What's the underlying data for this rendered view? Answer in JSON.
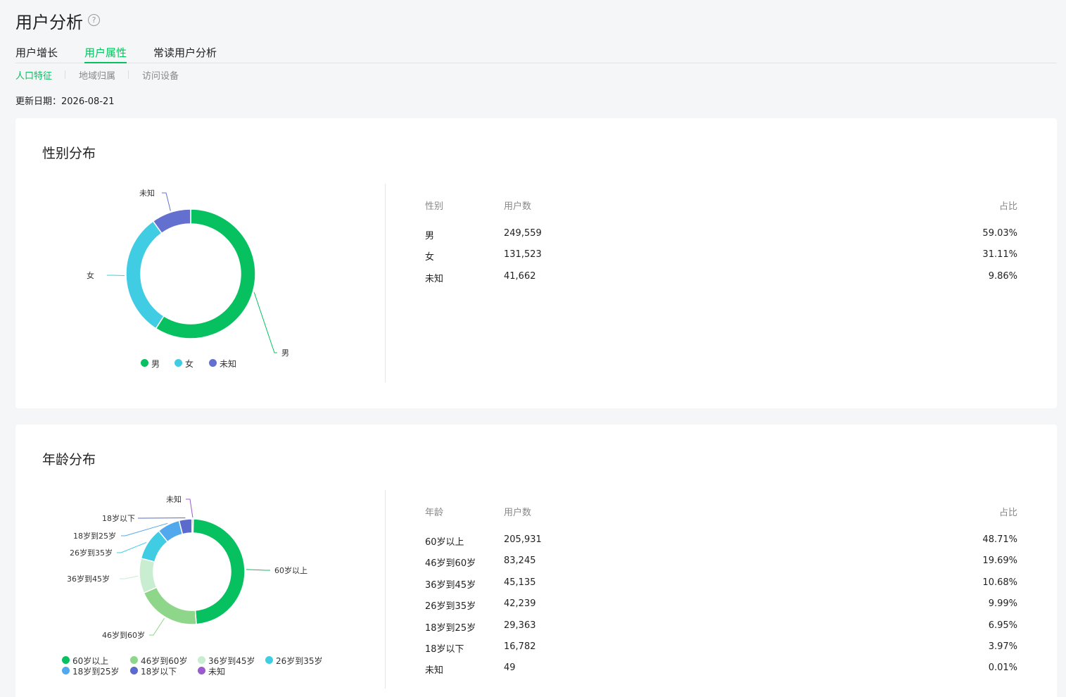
{
  "header": {
    "title": "用户分析",
    "help_icon": "?"
  },
  "tabs": [
    {
      "label": "用户增长"
    },
    {
      "label": "用户属性",
      "active": true
    },
    {
      "label": "常读用户分析"
    }
  ],
  "subtabs": [
    {
      "label": "人口特征",
      "active": true
    },
    {
      "label": "地域归属"
    },
    {
      "label": "访问设备"
    }
  ],
  "update": {
    "label": "更新日期：",
    "date": "2026-08-21"
  },
  "gender": {
    "title": "性别分布",
    "table": {
      "headers": [
        "性别",
        "用户数",
        "占比"
      ],
      "rows": [
        [
          "男",
          "249,559",
          "59.03%"
        ],
        [
          "女",
          "131,523",
          "31.11%"
        ],
        [
          "未知",
          "41,662",
          "9.86%"
        ]
      ]
    }
  },
  "age": {
    "title": "年龄分布",
    "table": {
      "headers": [
        "年龄",
        "用户数",
        "占比"
      ],
      "rows": [
        [
          "60岁以上",
          "205,931",
          "48.71%"
        ],
        [
          "46岁到60岁",
          "83,245",
          "19.69%"
        ],
        [
          "36岁到45岁",
          "45,135",
          "10.68%"
        ],
        [
          "26岁到35岁",
          "42,239",
          "9.99%"
        ],
        [
          "18岁到25岁",
          "29,363",
          "6.95%"
        ],
        [
          "18岁以下",
          "16,782",
          "3.97%"
        ],
        [
          "未知",
          "49",
          "0.01%"
        ]
      ]
    }
  },
  "chart_data": [
    {
      "type": "pie",
      "donut": true,
      "categories": [
        "男",
        "女",
        "未知"
      ],
      "values": [
        59.03,
        31.11,
        9.86
      ],
      "colors": [
        "#07c160",
        "#40cde3",
        "#6470d0"
      ],
      "legend": "bottom"
    },
    {
      "type": "pie",
      "donut": true,
      "categories": [
        "60岁以上",
        "46岁到60岁",
        "36岁到45岁",
        "26岁到35岁",
        "18岁到25岁",
        "18岁以下",
        "未知"
      ],
      "values": [
        48.71,
        19.69,
        10.68,
        9.99,
        6.95,
        3.97,
        0.01
      ],
      "colors": [
        "#07c160",
        "#8ed68a",
        "#c8edd0",
        "#40cde3",
        "#52a8ec",
        "#5a6bcd",
        "#9a5bd0"
      ],
      "legend": "bottom"
    }
  ]
}
